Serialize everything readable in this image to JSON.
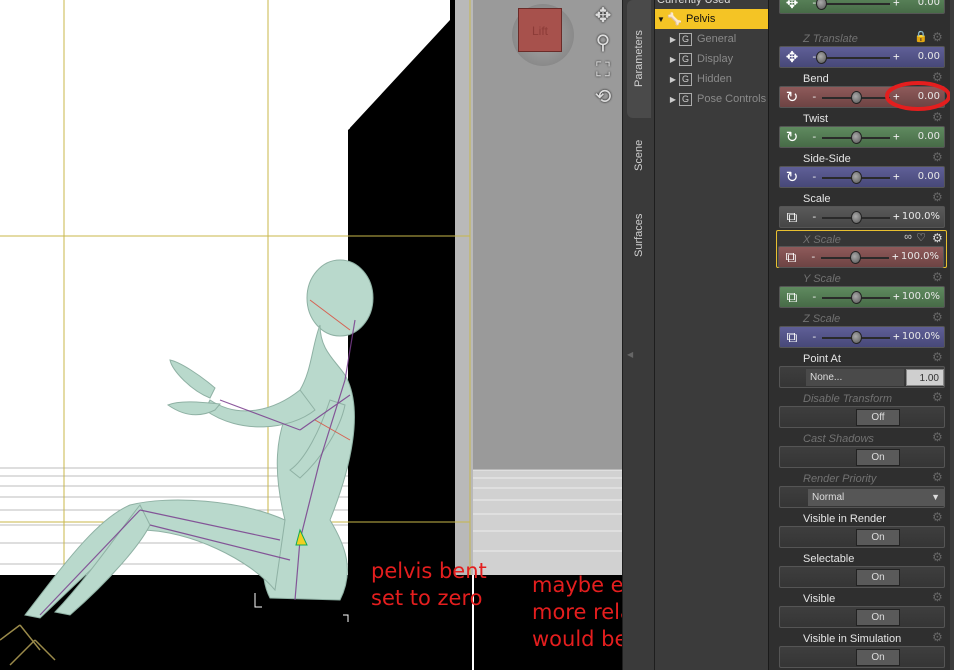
{
  "viewport": {
    "cube_label": "Lift",
    "nav_tools": [
      "move-icon",
      "zoom-icon",
      "frame-icon",
      "orbit-icon"
    ],
    "annotations": {
      "left": "pelvis bent\nset to zero",
      "right": "maybe even\nmore relaxing\nwould be good"
    }
  },
  "side_tabs": [
    "Parameters",
    "Scene",
    "Surfaces"
  ],
  "tree": {
    "header": "Currently Used",
    "items": [
      {
        "label": "Pelvis",
        "selected": true
      },
      {
        "label": "General",
        "selected": false
      },
      {
        "label": "Display",
        "selected": false
      },
      {
        "label": "Hidden",
        "selected": false
      },
      {
        "label": "Pose Controls",
        "selected": false
      }
    ]
  },
  "params": [
    {
      "label": "",
      "value": "0.00"
    },
    {
      "label": "Z Translate",
      "value": "0.00"
    },
    {
      "label": "Bend",
      "value": "0.00"
    },
    {
      "label": "Twist",
      "value": "0.00"
    },
    {
      "label": "Side-Side",
      "value": "0.00"
    },
    {
      "label": "Scale",
      "value": "100.0%"
    },
    {
      "label": "X Scale",
      "value": "100.0%"
    },
    {
      "label": "Y Scale",
      "value": "100.0%"
    },
    {
      "label": "Z Scale",
      "value": "100.0%"
    },
    {
      "label": "Point At",
      "button": "None...",
      "value": "1.00"
    },
    {
      "label": "Disable Transform",
      "value": "Off"
    },
    {
      "label": "Cast Shadows",
      "value": "On"
    },
    {
      "label": "Render Priority",
      "value": "Normal"
    },
    {
      "label": "Visible in Render",
      "value": "On"
    },
    {
      "label": "Selectable",
      "value": "On"
    },
    {
      "label": "Visible",
      "value": "On"
    },
    {
      "label": "Visible in Simulation",
      "value": "On"
    }
  ],
  "colors": {
    "highlight": "#f4c425",
    "annotation": "#e41e1e",
    "bend_circle": "#e41e1e"
  }
}
